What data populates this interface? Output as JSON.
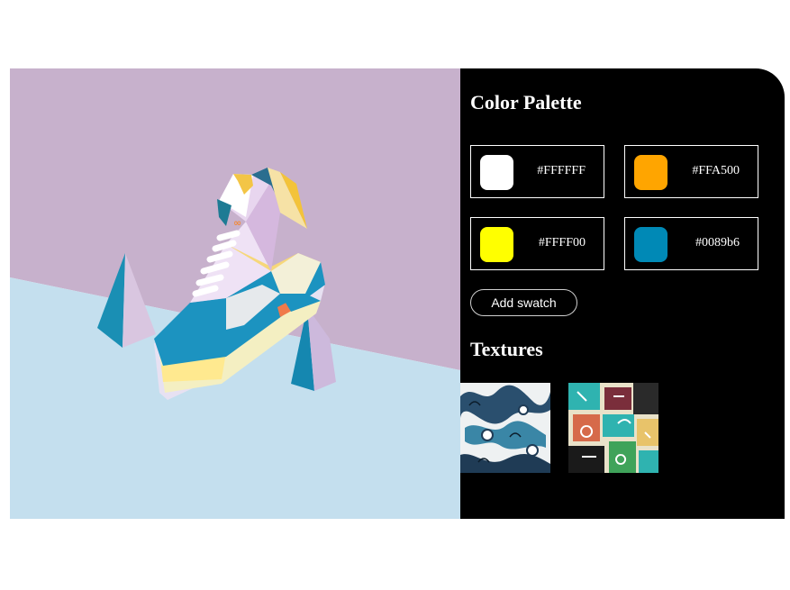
{
  "palette": {
    "heading": "Color Palette",
    "swatches": [
      {
        "hex": "#FFFFFF",
        "color": "#FFFFFF"
      },
      {
        "hex": "#FFA500",
        "color": "#FFA500"
      },
      {
        "hex": "#FFFF00",
        "color": "#FFFF00"
      },
      {
        "hex": "#0089b6",
        "color": "#0089b6"
      }
    ],
    "add_label": "Add swatch"
  },
  "textures": {
    "heading": "Textures",
    "items": [
      "texture-doodle-blue",
      "texture-doodle-teal"
    ]
  },
  "photo": {
    "subject": "low-poly paper sneaker"
  }
}
